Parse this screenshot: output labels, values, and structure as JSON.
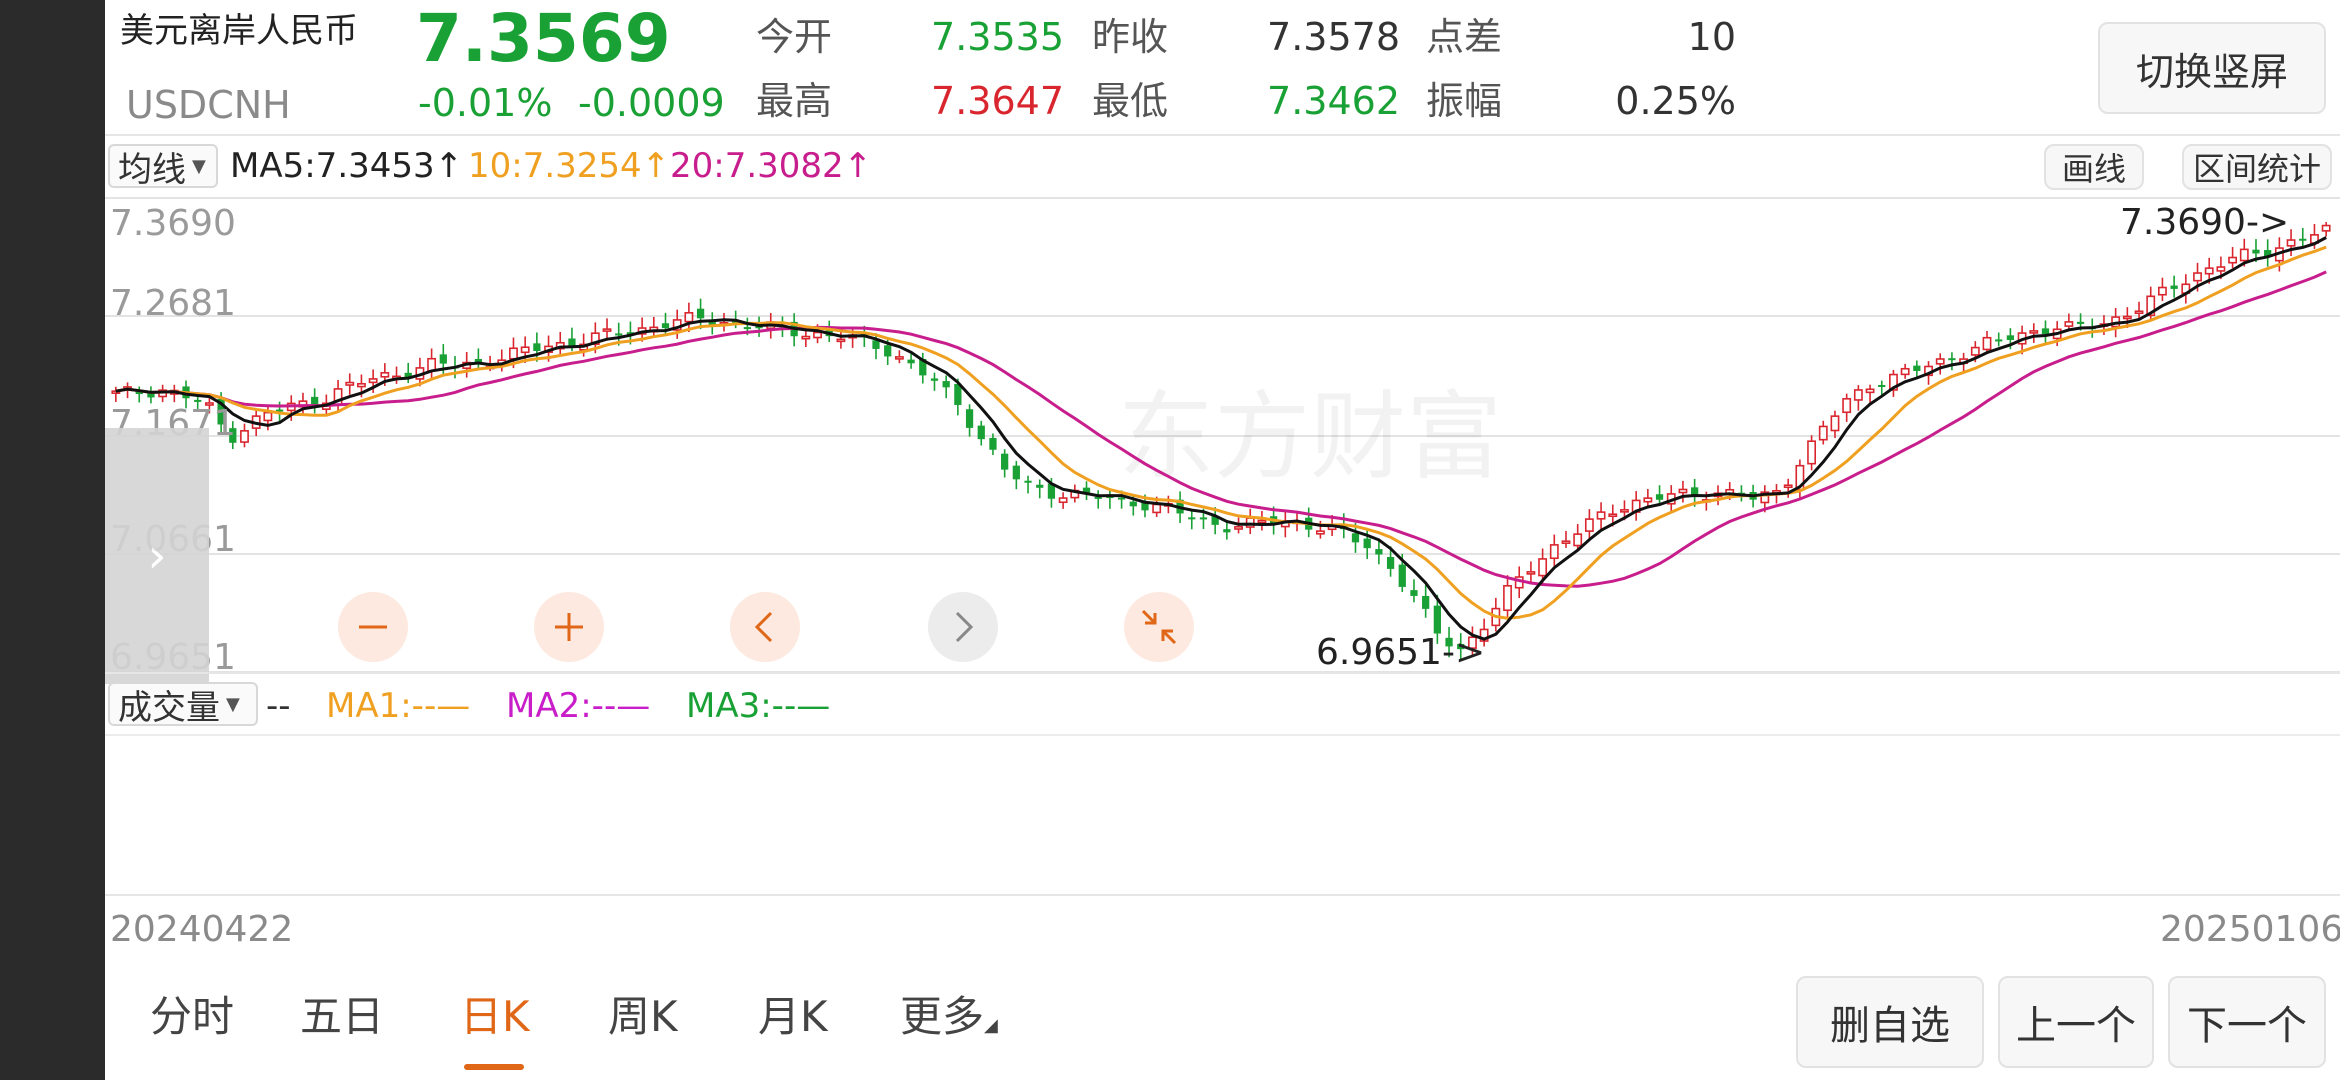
{
  "quote": {
    "name": "美元离岸人民币",
    "code": "USDCNH",
    "price": "7.3569",
    "change_pct": "-0.01%",
    "change": "-0.0009",
    "open_label": "今开",
    "open": "7.3535",
    "prev_close_label": "昨收",
    "prev_close": "7.3578",
    "spread_label": "点差",
    "spread": "10",
    "high_label": "最高",
    "high": "7.3647",
    "low_label": "最低",
    "low": "7.3462",
    "amplitude_label": "振幅",
    "amplitude": "0.25%"
  },
  "buttons": {
    "switch_portrait": "切换竖屏",
    "draw_line": "画线",
    "range_stats": "区间统计",
    "remove_favorite": "删自选",
    "prev": "上一个",
    "next": "下一个"
  },
  "indicator": {
    "selector": "均线",
    "ma5": "MA5:7.3453↑",
    "ma10": "10:7.3254↑",
    "ma20": "20:7.3082↑"
  },
  "volume": {
    "selector": "成交量",
    "dash": "--",
    "ma1": "MA1:--—",
    "ma2": "MA2:--—",
    "ma3": "MA3:--—"
  },
  "axis": {
    "y_ticks": [
      "7.3690",
      "7.2681",
      "7.1671",
      "7.0661",
      "6.9651"
    ],
    "max_marker": "7.3690->",
    "min_marker": "6.9651->",
    "start_date": "20240422",
    "end_date": "20250106"
  },
  "tabs": [
    "分时",
    "五日",
    "日K",
    "周K",
    "月K",
    "更多"
  ],
  "active_tab": "日K",
  "watermark": "东方财富",
  "colors": {
    "up": "#d9262e",
    "down": "#1aa135",
    "ma5": "#111111",
    "ma10": "#f0a020",
    "ma20": "#c81d8c",
    "accent": "#e06717"
  },
  "chart_data": {
    "type": "candlestick",
    "x_range": [
      "20240422",
      "20250106"
    ],
    "ylim": [
      6.9651,
      7.369
    ],
    "close_trend": [
      7.21,
      7.212,
      7.215,
      7.208,
      7.2,
      7.17,
      7.185,
      7.195,
      7.2,
      7.205,
      7.215,
      7.222,
      7.228,
      7.232,
      7.238,
      7.236,
      7.24,
      7.244,
      7.25,
      7.255,
      7.258,
      7.262,
      7.266,
      7.27,
      7.275,
      7.278,
      7.28,
      7.276,
      7.272,
      7.27,
      7.268,
      7.265,
      7.262,
      7.258,
      7.25,
      7.235,
      7.22,
      7.2,
      7.17,
      7.14,
      7.125,
      7.12,
      7.118,
      7.115,
      7.112,
      7.11,
      7.105,
      7.098,
      7.092,
      7.088,
      7.09,
      7.094,
      7.092,
      7.086,
      7.08,
      7.07,
      7.05,
      7.02,
      6.99,
      6.975,
      6.995,
      7.025,
      7.05,
      7.068,
      7.08,
      7.095,
      7.108,
      7.112,
      7.115,
      7.118,
      7.12,
      7.118,
      7.112,
      7.122,
      7.15,
      7.18,
      7.205,
      7.22,
      7.225,
      7.232,
      7.24,
      7.248,
      7.255,
      7.262,
      7.268,
      7.272,
      7.27,
      7.275,
      7.282,
      7.292,
      7.305,
      7.318,
      7.328,
      7.335,
      7.34,
      7.347,
      7.355,
      7.36
    ]
  }
}
